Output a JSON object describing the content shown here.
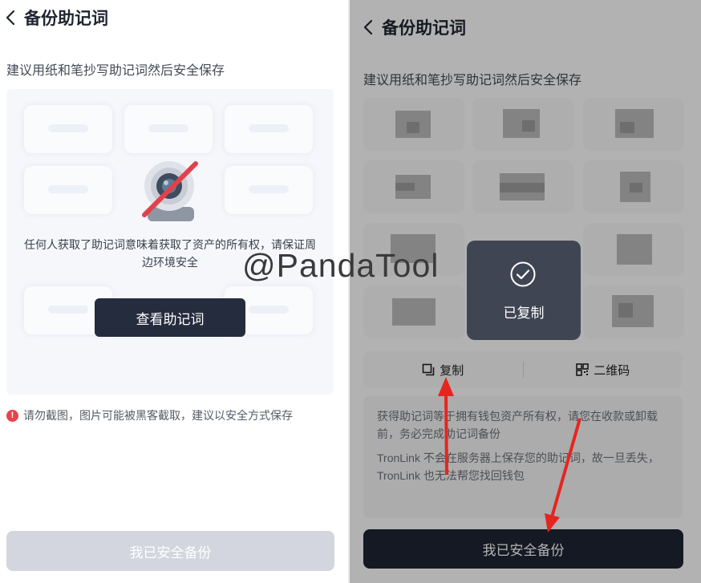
{
  "left_screen": {
    "title": "备份助记词",
    "subtitle": "建议用纸和笔抄写助记词然后安全保存",
    "warning": "任何人获取了助记词意味着获取了资产的所有权，请保证周边环境安全",
    "view_button": "查看助记词",
    "notice": "请勿截图，图片可能被黑客截取，建议以安全方式保存",
    "notice_icon": "!",
    "confirm_button": "我已安全备份"
  },
  "right_screen": {
    "title": "备份助记词",
    "subtitle": "建议用纸和笔抄写助记词然后安全保存",
    "copy_label": "复制",
    "qr_label": "二维码",
    "info_1": "获得助记词等于拥有钱包资产所有权，请您在收款或卸载前，务必完成助记词备份",
    "info_2": "TronLink 不会在服务器上保存您的助记词，故一旦丢失，TronLink 也无法帮您找回钱包",
    "confirm_button": "我已安全备份",
    "toast_text": "已复制"
  },
  "watermark": "@PandaTool",
  "colors": {
    "primary_dark": "#252c3d",
    "disabled_button": "#d3d6de",
    "warning_red": "#e8424a",
    "arrow_red": "#e5261f"
  },
  "icons": [
    "back-arrow-icon",
    "camera-blocked-icon",
    "warning-icon",
    "copy-icon",
    "qr-code-icon",
    "check-circle-icon"
  ]
}
